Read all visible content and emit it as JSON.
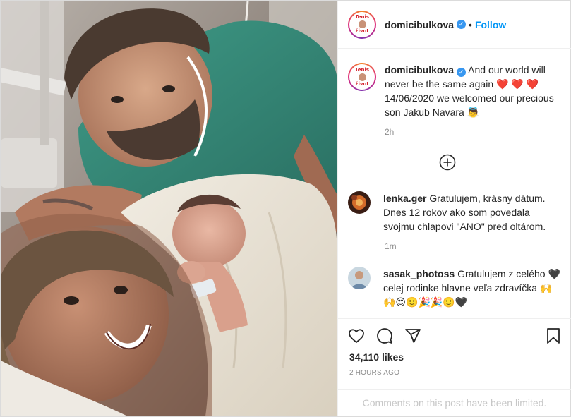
{
  "post": {
    "username": "domicibulkova",
    "follow_label": "Follow",
    "avatar_top_text": "Tenis",
    "avatar_bottom_text": "život"
  },
  "caption": {
    "username": "domicibulkova",
    "text_1": "And our world will never be the same again",
    "hearts": "❤️ ❤️ ❤️",
    "text_2": "14/06/2020 we welcomed our precious son Jakub Navara",
    "emoji_end": "👼",
    "time": "2h"
  },
  "comments": [
    {
      "username": "lenka.ger",
      "text": "Gratulujem, krásny dátum. Dnes 12 rokov ako som povedala svojmu chlapovi \"ANO\" pred oltárom.",
      "time": "1m"
    },
    {
      "username": "sasak_photoss",
      "text": "Gratulujem z celého",
      "text_cont": "celej rodinke hlavne veľa zdravíčka",
      "heart": "🖤",
      "emoji_row_1": "🙌",
      "emoji_row_2": "🙌😍🙂🎉🎉🙂🖤"
    }
  ],
  "footer": {
    "likes": "34,110 likes",
    "posted": "2 HOURS AGO",
    "limited": "Comments on this post have been limited."
  },
  "icons": [
    "heart-icon",
    "comment-icon",
    "share-icon",
    "bookmark-icon",
    "add-comment-icon",
    "verified-icon"
  ],
  "colors": {
    "link": "#0095f6",
    "verified": "#3897f0",
    "muted": "#8e8e8e"
  }
}
